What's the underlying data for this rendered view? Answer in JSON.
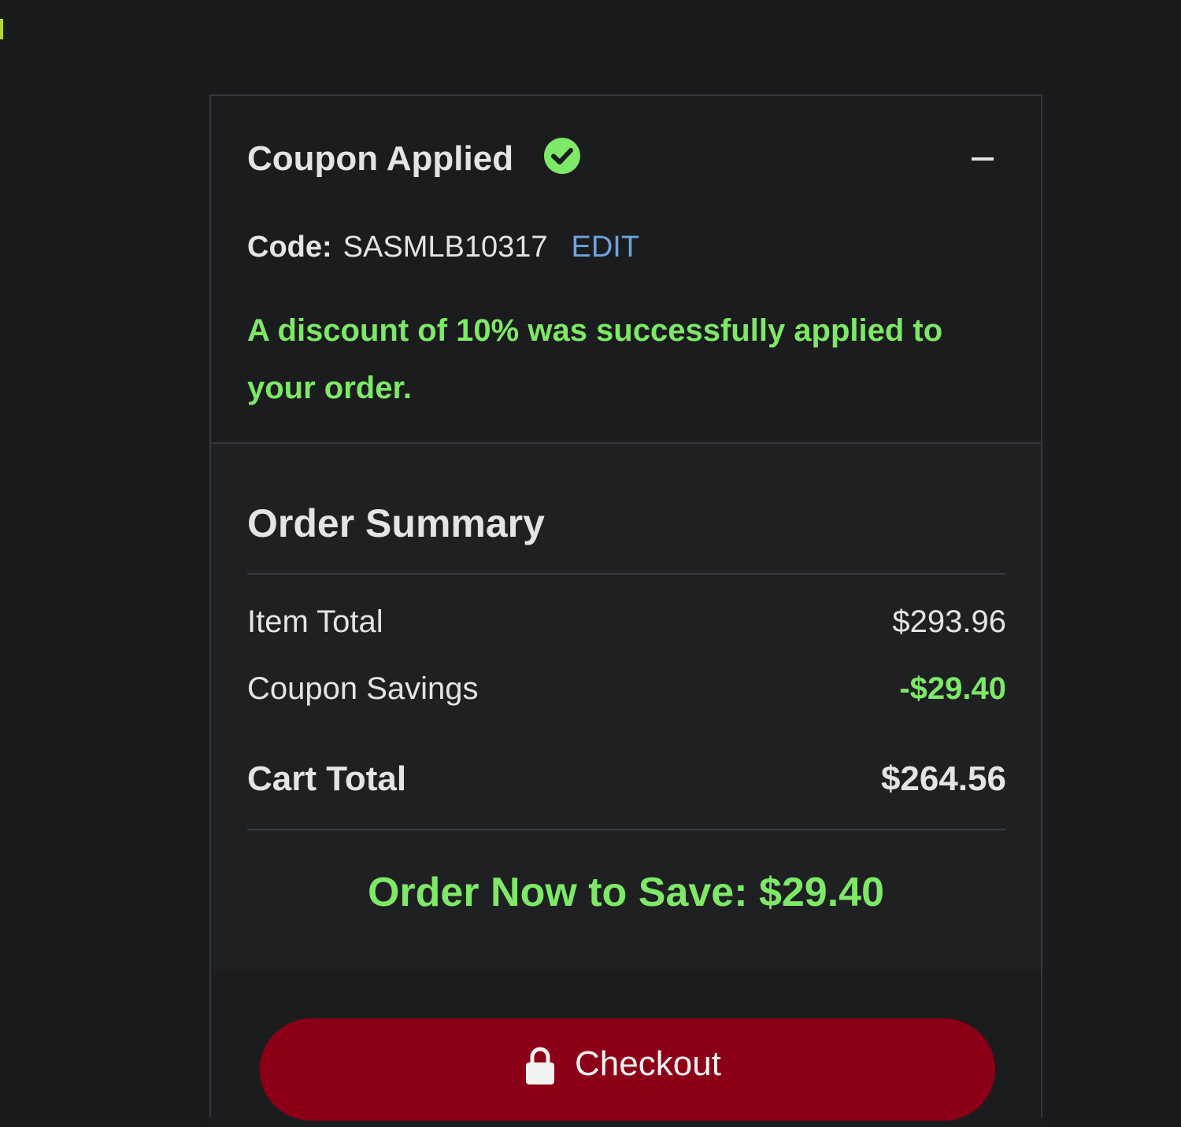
{
  "coupon": {
    "title": "Coupon Applied",
    "status_icon": "check-circle-icon",
    "collapse_icon": "minus-icon",
    "code_label": "Code:",
    "code_value": "SASMLB10317",
    "edit_label": "EDIT",
    "message": "A discount of 10% was successfully applied to your order."
  },
  "summary": {
    "title": "Order Summary",
    "rows": [
      {
        "label": "Item Total",
        "value": "$293.96"
      },
      {
        "label": "Coupon Savings",
        "value": "-$29.40"
      },
      {
        "label": "Cart Total",
        "value": "$264.56"
      }
    ],
    "save_banner": "Order Now to Save: $29.40"
  },
  "checkout": {
    "label": "Checkout",
    "icon": "lock-icon"
  },
  "colors": {
    "accent_green": "#7ee867",
    "link_blue": "#6fa3dc",
    "checkout_red": "#8c0017",
    "background": "#1a1b1d"
  }
}
